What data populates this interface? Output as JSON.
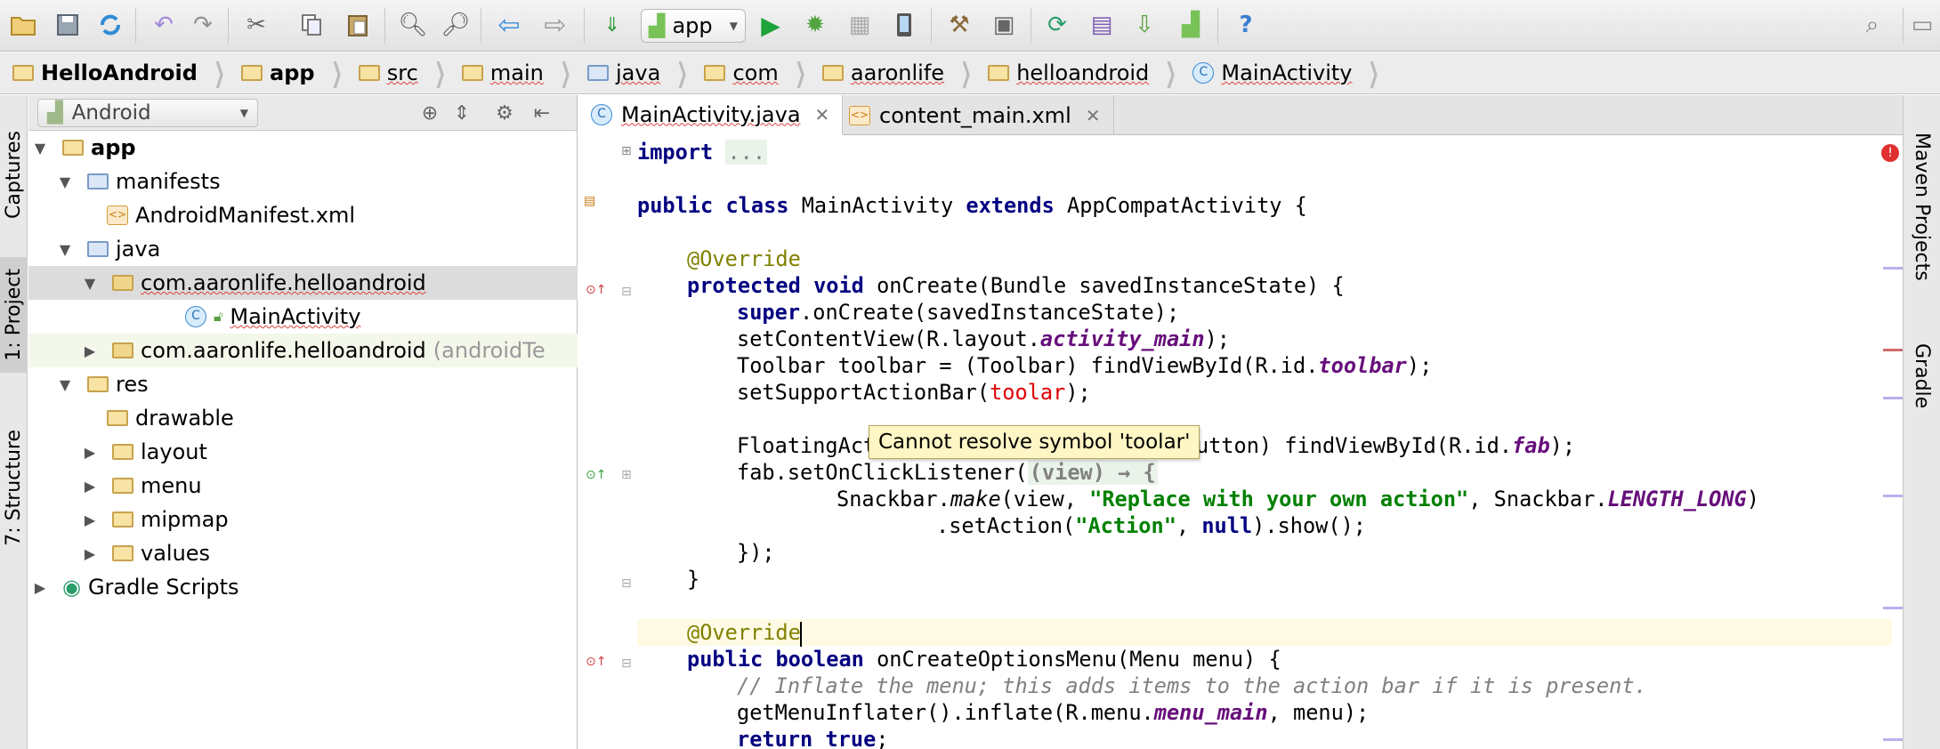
{
  "toolbar": {
    "run_config": "app",
    "icons": [
      "open-folder-icon",
      "save-icon",
      "sync-icon",
      "undo-icon",
      "redo-icon",
      "cut-icon",
      "copy-icon",
      "paste-icon",
      "find-icon",
      "replace-icon",
      "back-icon",
      "forward-icon",
      "make-project-icon",
      "android-icon",
      "play-icon",
      "debug-icon",
      "attach-debugger-icon",
      "device-icon",
      "project-structure-icon",
      "sdk-manager-icon",
      "avd-manager-icon",
      "gradle-sync-icon",
      "android-device-monitor-icon",
      "help-icon",
      "search-everywhere-icon"
    ]
  },
  "breadcrumb": [
    {
      "label": "HelloAndroid",
      "bold": true
    },
    {
      "label": "app",
      "bold": true
    },
    {
      "label": "src"
    },
    {
      "label": "main"
    },
    {
      "label": "java"
    },
    {
      "label": "com"
    },
    {
      "label": "aaronlife"
    },
    {
      "label": "helloandroid"
    },
    {
      "label": "MainActivity"
    }
  ],
  "left_strip": {
    "captures": "Captures",
    "project": "1: Project",
    "structure": "7: Structure"
  },
  "right_strip": {
    "maven": "Maven Projects",
    "gradle": "Gradle"
  },
  "project_panel": {
    "view_mode": "Android",
    "tree": [
      {
        "label": "app",
        "bold": true
      },
      {
        "label": "manifests"
      },
      {
        "label": "AndroidManifest.xml"
      },
      {
        "label": "java"
      },
      {
        "label": "com.aaronlife.helloandroid"
      },
      {
        "label": "MainActivity"
      },
      {
        "label": "com.aaronlife.helloandroid",
        "suffix": "(androidTe"
      },
      {
        "label": "res"
      },
      {
        "label": "drawable"
      },
      {
        "label": "layout"
      },
      {
        "label": "menu"
      },
      {
        "label": "mipmap"
      },
      {
        "label": "values"
      },
      {
        "label": "Gradle Scripts"
      }
    ]
  },
  "editor": {
    "tabs": [
      {
        "label": "MainActivity.java",
        "active": true
      },
      {
        "label": "content_main.xml",
        "active": false
      }
    ],
    "tooltip": "Cannot resolve symbol 'toolar'",
    "code": {
      "import_kw": "import",
      "import_fold": "...",
      "l2_public": "public",
      "l2_class": "class",
      "l2_name": " MainActivity ",
      "l2_extends": "extends",
      "l2_rest": " AppCompatActivity {",
      "override": "@Override",
      "l4_protected": "protected",
      "l4_void": "void",
      "l4_rest": " onCreate(Bundle savedInstanceState) {",
      "l5_super": "super",
      "l5_rest": ".onCreate(savedInstanceState);",
      "l6_a": "setContentView(R.layout.",
      "l6_f": "activity_main",
      "l6_b": ");",
      "l7_a": "Toolbar toolbar = (Toolbar) findViewById(R.id.",
      "l7_f": "toolbar",
      "l7_b": ");",
      "l8_a": "setSupportActionBar(",
      "l8_err": "toolar",
      "l8_b": ");",
      "l9_a": "FloatingAct",
      "l9_b": "gActionButton) findViewById(R.id.",
      "l9_f": "fab",
      "l9_c": ");",
      "l10_a": "fab.setOnClickListener(",
      "l10_lam": "(view) → {",
      "l11_a": "Snackbar.",
      "l11_make": "make",
      "l11_b": "(view, ",
      "l11_str": "\"Replace with your own action\"",
      "l11_c": ", Snackbar.",
      "l11_f": "LENGTH_LONG",
      "l11_d": ")",
      "l12_a": ".setAction(",
      "l12_str": "\"Action\"",
      "l12_b": ", ",
      "l12_null": "null",
      "l12_c": ").show();",
      "l13": "});",
      "l14": "}",
      "l16_public": "public",
      "l16_bool": "boolean",
      "l16_rest": " onCreateOptionsMenu(Menu menu) {",
      "l17": "// Inflate the menu; this adds items to the action bar if it is present.",
      "l18_a": "getMenuInflater().inflate(R.menu.",
      "l18_f": "menu_main",
      "l18_b": ", menu);",
      "l19_ret": "return",
      "l19_true": "true",
      "l19_b": ";"
    }
  },
  "colors": {
    "keyword": "#000080",
    "annotation": "#808000",
    "string": "#008000",
    "field": "#660e7a",
    "error": "#e00000",
    "tooltip_bg": "#fff6c5"
  }
}
